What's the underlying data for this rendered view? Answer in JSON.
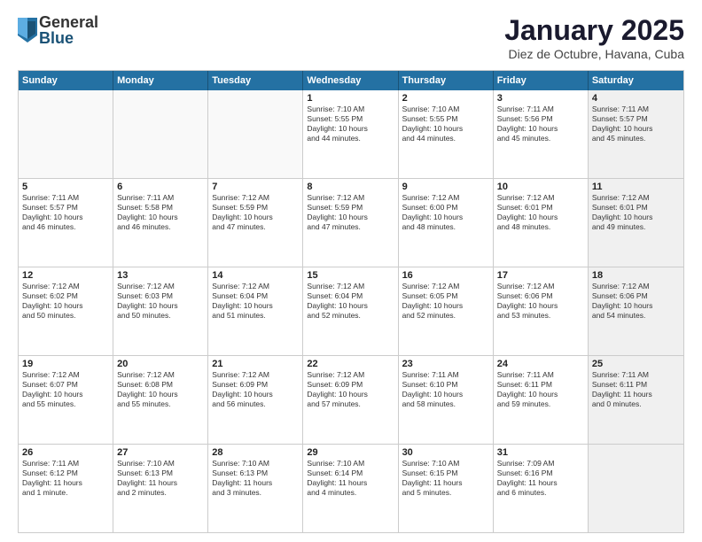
{
  "logo": {
    "general": "General",
    "blue": "Blue"
  },
  "title": "January 2025",
  "subtitle": "Diez de Octubre, Havana, Cuba",
  "header": {
    "days": [
      "Sunday",
      "Monday",
      "Tuesday",
      "Wednesday",
      "Thursday",
      "Friday",
      "Saturday"
    ]
  },
  "rows": [
    {
      "cells": [
        {
          "day": "",
          "content": "",
          "empty": true
        },
        {
          "day": "",
          "content": "",
          "empty": true
        },
        {
          "day": "",
          "content": "",
          "empty": true
        },
        {
          "day": "1",
          "content": "Sunrise: 7:10 AM\nSunset: 5:55 PM\nDaylight: 10 hours\nand 44 minutes."
        },
        {
          "day": "2",
          "content": "Sunrise: 7:10 AM\nSunset: 5:55 PM\nDaylight: 10 hours\nand 44 minutes."
        },
        {
          "day": "3",
          "content": "Sunrise: 7:11 AM\nSunset: 5:56 PM\nDaylight: 10 hours\nand 45 minutes."
        },
        {
          "day": "4",
          "content": "Sunrise: 7:11 AM\nSunset: 5:57 PM\nDaylight: 10 hours\nand 45 minutes.",
          "shaded": true
        }
      ]
    },
    {
      "cells": [
        {
          "day": "5",
          "content": "Sunrise: 7:11 AM\nSunset: 5:57 PM\nDaylight: 10 hours\nand 46 minutes."
        },
        {
          "day": "6",
          "content": "Sunrise: 7:11 AM\nSunset: 5:58 PM\nDaylight: 10 hours\nand 46 minutes."
        },
        {
          "day": "7",
          "content": "Sunrise: 7:12 AM\nSunset: 5:59 PM\nDaylight: 10 hours\nand 47 minutes."
        },
        {
          "day": "8",
          "content": "Sunrise: 7:12 AM\nSunset: 5:59 PM\nDaylight: 10 hours\nand 47 minutes."
        },
        {
          "day": "9",
          "content": "Sunrise: 7:12 AM\nSunset: 6:00 PM\nDaylight: 10 hours\nand 48 minutes."
        },
        {
          "day": "10",
          "content": "Sunrise: 7:12 AM\nSunset: 6:01 PM\nDaylight: 10 hours\nand 48 minutes."
        },
        {
          "day": "11",
          "content": "Sunrise: 7:12 AM\nSunset: 6:01 PM\nDaylight: 10 hours\nand 49 minutes.",
          "shaded": true
        }
      ]
    },
    {
      "cells": [
        {
          "day": "12",
          "content": "Sunrise: 7:12 AM\nSunset: 6:02 PM\nDaylight: 10 hours\nand 50 minutes."
        },
        {
          "day": "13",
          "content": "Sunrise: 7:12 AM\nSunset: 6:03 PM\nDaylight: 10 hours\nand 50 minutes."
        },
        {
          "day": "14",
          "content": "Sunrise: 7:12 AM\nSunset: 6:04 PM\nDaylight: 10 hours\nand 51 minutes."
        },
        {
          "day": "15",
          "content": "Sunrise: 7:12 AM\nSunset: 6:04 PM\nDaylight: 10 hours\nand 52 minutes."
        },
        {
          "day": "16",
          "content": "Sunrise: 7:12 AM\nSunset: 6:05 PM\nDaylight: 10 hours\nand 52 minutes."
        },
        {
          "day": "17",
          "content": "Sunrise: 7:12 AM\nSunset: 6:06 PM\nDaylight: 10 hours\nand 53 minutes."
        },
        {
          "day": "18",
          "content": "Sunrise: 7:12 AM\nSunset: 6:06 PM\nDaylight: 10 hours\nand 54 minutes.",
          "shaded": true
        }
      ]
    },
    {
      "cells": [
        {
          "day": "19",
          "content": "Sunrise: 7:12 AM\nSunset: 6:07 PM\nDaylight: 10 hours\nand 55 minutes."
        },
        {
          "day": "20",
          "content": "Sunrise: 7:12 AM\nSunset: 6:08 PM\nDaylight: 10 hours\nand 55 minutes."
        },
        {
          "day": "21",
          "content": "Sunrise: 7:12 AM\nSunset: 6:09 PM\nDaylight: 10 hours\nand 56 minutes."
        },
        {
          "day": "22",
          "content": "Sunrise: 7:12 AM\nSunset: 6:09 PM\nDaylight: 10 hours\nand 57 minutes."
        },
        {
          "day": "23",
          "content": "Sunrise: 7:11 AM\nSunset: 6:10 PM\nDaylight: 10 hours\nand 58 minutes."
        },
        {
          "day": "24",
          "content": "Sunrise: 7:11 AM\nSunset: 6:11 PM\nDaylight: 10 hours\nand 59 minutes."
        },
        {
          "day": "25",
          "content": "Sunrise: 7:11 AM\nSunset: 6:11 PM\nDaylight: 11 hours\nand 0 minutes.",
          "shaded": true
        }
      ]
    },
    {
      "cells": [
        {
          "day": "26",
          "content": "Sunrise: 7:11 AM\nSunset: 6:12 PM\nDaylight: 11 hours\nand 1 minute."
        },
        {
          "day": "27",
          "content": "Sunrise: 7:10 AM\nSunset: 6:13 PM\nDaylight: 11 hours\nand 2 minutes."
        },
        {
          "day": "28",
          "content": "Sunrise: 7:10 AM\nSunset: 6:13 PM\nDaylight: 11 hours\nand 3 minutes."
        },
        {
          "day": "29",
          "content": "Sunrise: 7:10 AM\nSunset: 6:14 PM\nDaylight: 11 hours\nand 4 minutes."
        },
        {
          "day": "30",
          "content": "Sunrise: 7:10 AM\nSunset: 6:15 PM\nDaylight: 11 hours\nand 5 minutes."
        },
        {
          "day": "31",
          "content": "Sunrise: 7:09 AM\nSunset: 6:16 PM\nDaylight: 11 hours\nand 6 minutes."
        },
        {
          "day": "",
          "content": "",
          "empty": true,
          "shaded": true
        }
      ]
    }
  ]
}
